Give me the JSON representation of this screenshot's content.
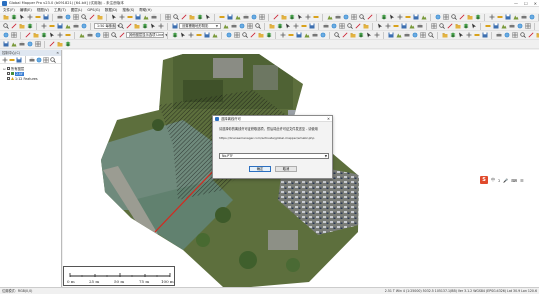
{
  "app": {
    "title": "Global Mapper Pro v23.0 (b091821) [64-bit] (试用版) - 未注册版本",
    "window_controls": [
      "—",
      "☐",
      "✕"
    ]
  },
  "menu": [
    "文件(F)",
    "编辑(E)",
    "视图(V)",
    "工具(T)",
    "图层(L)",
    "GPS(G)",
    "数据(D)",
    "搜索(S)",
    "帮助(H)"
  ],
  "toolbar": {
    "scale_combo": "1:50  每像素",
    "style_combo": "设置栅格地形阴影",
    "layer_combo": "其他图层显示选项  Line"
  },
  "left_panel": {
    "title": "控制中心(C)",
    "close": "✕",
    "tree": [
      {
        "label": "所有图层",
        "level": 0,
        "expanded": true
      },
      {
        "label": "2.tif",
        "level": 1,
        "selected": true
      },
      {
        "label": "1:12  Features",
        "level": 1,
        "selected": false
      }
    ]
  },
  "dialog": {
    "title": "选择离线许可",
    "close": "✕",
    "message": "请选择你的离线许可证获取选项，然后将此许可证文件发送至 - 请使用",
    "url": "https://licensemanager.com/activate/global-mapper/emaliz.php",
    "select_value": "No.PTF",
    "ok_label": "确定",
    "cancel_label": "取消"
  },
  "scalebar": {
    "labels": [
      "0 m",
      "25 m",
      "50 m",
      "75 m",
      "100 m"
    ]
  },
  "status": {
    "left": "位置模式：RGB(0,0)",
    "right": "2.51 T  Win 4 (1:25000)  5032.5 105137.1(BB)  Ver 3.1.2  WGS84 (EPSG:4326)  Lat 30.9  Lon 120.6"
  },
  "ime": {
    "logo": "S",
    "glyphs": [
      "中",
      "ɔ",
      "🎤",
      "⌨",
      "☰"
    ]
  },
  "colors": {
    "accent": "#3a7fd5",
    "arrow": "#d9261c",
    "imagery_green": "#5d6f3d",
    "water": "#6f8a7c"
  }
}
